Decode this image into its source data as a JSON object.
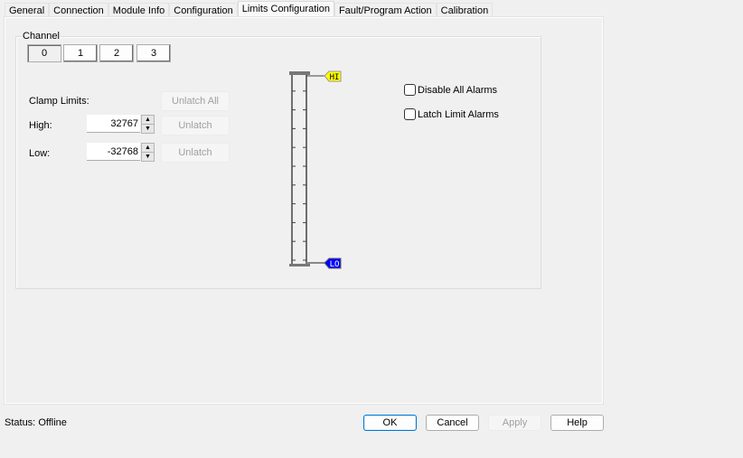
{
  "tabs": [
    {
      "label": "General",
      "active": false
    },
    {
      "label": "Connection",
      "active": false
    },
    {
      "label": "Module Info",
      "active": false
    },
    {
      "label": "Configuration",
      "active": false
    },
    {
      "label": "Limits Configuration",
      "active": true
    },
    {
      "label": "Fault/Program Action",
      "active": false
    },
    {
      "label": "Calibration",
      "active": false
    }
  ],
  "channel": {
    "legend": "Channel",
    "buttons": [
      "0",
      "1",
      "2",
      "3"
    ],
    "selected": "0"
  },
  "clamp": {
    "label": "Clamp Limits:",
    "unlatch_all": "Unlatch All",
    "high_label": "High:",
    "high_value": "32767",
    "low_label": "Low:",
    "low_value": "-32768",
    "unlatch": "Unlatch"
  },
  "gauge": {
    "hi_tag": "HI",
    "lo_tag": "LO",
    "hi_color": "#ffff00",
    "lo_color": "#0000ff"
  },
  "options": {
    "disable_all_alarms": {
      "label": "Disable All Alarms",
      "checked": false
    },
    "latch_limit_alarms": {
      "label": "Latch Limit Alarms",
      "checked": false
    }
  },
  "status": {
    "label": "Status:",
    "value": "Offline"
  },
  "footer": {
    "ok": "OK",
    "cancel": "Cancel",
    "apply": "Apply",
    "help": "Help"
  }
}
